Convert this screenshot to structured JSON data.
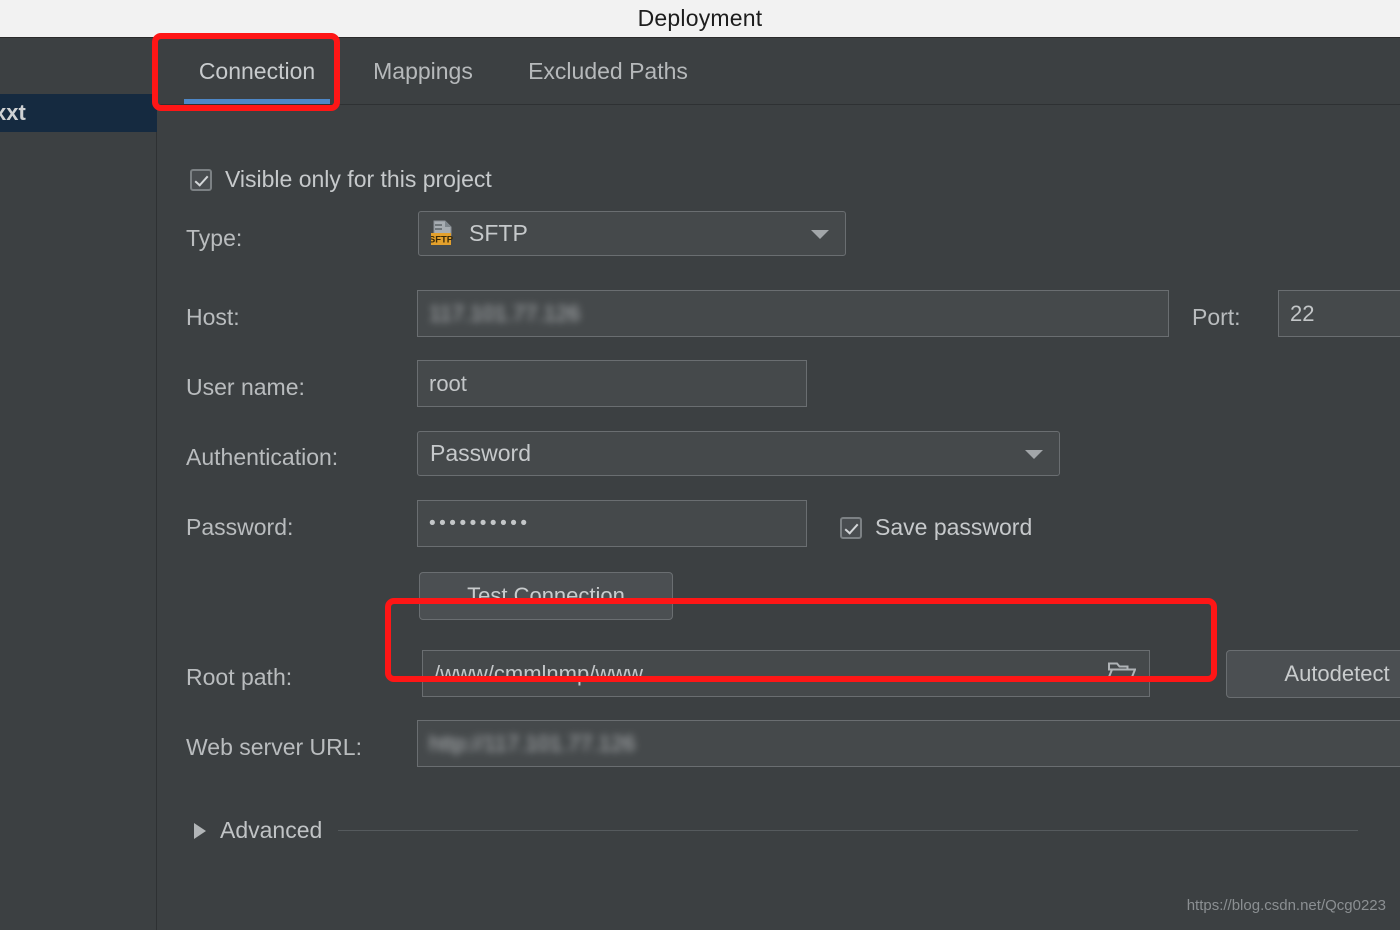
{
  "window": {
    "title": "Deployment"
  },
  "sidebar": {
    "items": [
      {
        "label": "xxt",
        "selected": true
      }
    ]
  },
  "tabs": [
    {
      "label": "Connection",
      "active": true
    },
    {
      "label": "Mappings",
      "active": false
    },
    {
      "label": "Excluded Paths",
      "active": false
    }
  ],
  "form": {
    "visible_only_checkbox": {
      "label": "Visible only for this project",
      "checked": true
    },
    "type": {
      "label": "Type:",
      "value": "SFTP",
      "icon": "sftp-icon",
      "badge_text": "SFTP"
    },
    "host": {
      "label": "Host:",
      "value": "117.101.77.126",
      "redacted": true
    },
    "port": {
      "label": "Port:",
      "value": "22"
    },
    "user_name": {
      "label": "User name:",
      "value": "root"
    },
    "authentication": {
      "label": "Authentication:",
      "value": "Password"
    },
    "password": {
      "label": "Password:",
      "value": "••••••••••"
    },
    "save_password": {
      "label": "Save password",
      "checked": true
    },
    "test_connection": {
      "label": "Test Connection"
    },
    "root_path": {
      "label": "Root path:",
      "value": "/www/cmmlnmp/www",
      "browse_icon": "folder-icon"
    },
    "autodetect": {
      "label": "Autodetect"
    },
    "web_server_url": {
      "label": "Web server URL:",
      "value": "http://117.101.77.126",
      "redacted": true,
      "open_icon": "globe-icon"
    },
    "advanced": {
      "label": "Advanced",
      "expanded": false
    }
  },
  "watermark": {
    "text": "https://blog.csdn.net/Qcg0223"
  },
  "colors": {
    "accent": "#4d87c7",
    "annotation": "#fe1616",
    "panel_bg": "#3c4042",
    "titlebar_bg": "#f2f2f2",
    "sidebar_selected": "#152a40",
    "sftp_badge": "#e3a02c"
  }
}
